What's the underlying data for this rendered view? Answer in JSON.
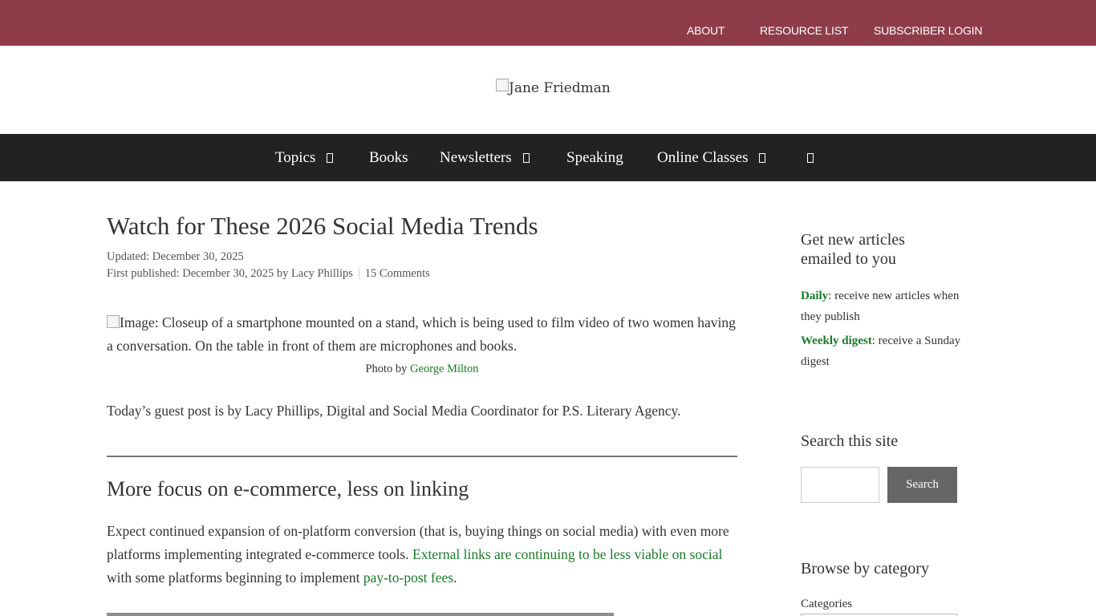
{
  "topbar": {
    "about": "ABOUT",
    "resource_list": "RESOURCE LIST",
    "subscriber_login": "SUBSCRIBER LOGIN"
  },
  "logo": {
    "alt_text": "Jane Friedman"
  },
  "nav": {
    "topics": "Topics",
    "books": "Books",
    "newsletters": "Newsletters",
    "speaking": "Speaking",
    "online_classes": "Online Classes"
  },
  "article": {
    "title": "Watch for These 2026 Social Media Trends",
    "updated": "Updated: December 30, 2025",
    "first_published": "First published: December 30, 2025 by Lacy Phillips",
    "comments": "15 Comments",
    "image_alt": "Image: Closeup of a smartphone mounted on a stand, which is being used to film video of two women having a conversation. On the table in front of them are microphones and books.",
    "caption_prefix": "Photo by",
    "caption_author": "George Milton",
    "intro": "Today’s guest post is by Lacy Phillips, Digital and Social Media Coordinator for P.S. Literary Agency.",
    "section_title": "More focus on e-commerce, less on linking",
    "para_1": "Expect continued expansion of on-platform conversion (that is, buying things on social media) with even more platforms implementing integrated e-commerce tools.",
    "para_link_1": "External links are continuing to be less viable on social",
    "para_2": "with some platforms beginning to implement",
    "para_link_2": "pay-to-post fees",
    "para_3": "."
  },
  "sidebar": {
    "newsletter_heading": "Get new articles emailed to you",
    "daily_link": "Daily",
    "daily_text": ": receive new articles when they publish",
    "weekly_link": "Weekly digest",
    "weekly_text": ": receive a Sunday digest",
    "search_heading": "Search this site",
    "search_button": "Search",
    "browse_heading": "Browse by category",
    "categories_label": "Categories"
  },
  "colors": {
    "topbar": "#8e3c4a",
    "nav": "#222222",
    "link": "#1a7a2a",
    "button": "#666666"
  }
}
